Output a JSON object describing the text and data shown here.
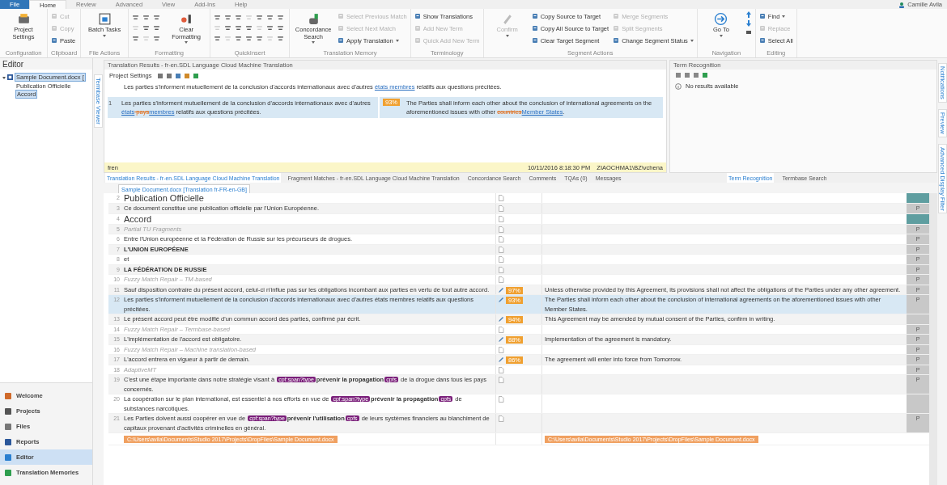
{
  "ribbon": {
    "tabs": [
      {
        "label": "File",
        "kind": "file",
        "selected": false
      },
      {
        "label": "Home",
        "kind": "tab",
        "selected": true
      },
      {
        "label": "Review",
        "kind": "tab",
        "selected": false
      },
      {
        "label": "Advanced",
        "kind": "tab",
        "selected": false
      },
      {
        "label": "View",
        "kind": "tab",
        "selected": false
      },
      {
        "label": "Add-Ins",
        "kind": "tab",
        "selected": false
      },
      {
        "label": "Help",
        "kind": "tab",
        "selected": false
      }
    ],
    "user": "Camille Avila",
    "groups": [
      {
        "label": "Configuration",
        "items": [
          {
            "kind": "large",
            "label": "Project Settings",
            "dropdown": false,
            "disabled": false
          }
        ]
      },
      {
        "label": "Clipboard",
        "items": [
          {
            "kind": "small",
            "label": "Cut",
            "dropdown": false,
            "disabled": true
          },
          {
            "kind": "small",
            "label": "Copy",
            "dropdown": false,
            "disabled": true
          },
          {
            "kind": "small",
            "label": "Paste",
            "dropdown": false,
            "disabled": false
          }
        ]
      },
      {
        "label": "File Actions",
        "items": [
          {
            "kind": "large",
            "label": "Batch Tasks",
            "dropdown": true,
            "disabled": false
          }
        ]
      },
      {
        "label": "Formatting",
        "items": [
          {
            "kind": "grid"
          },
          {
            "kind": "large",
            "label": "Clear Formatting",
            "dropdown": true,
            "disabled": false
          }
        ]
      },
      {
        "label": "QuickInsert",
        "items": [
          {
            "kind": "grid"
          }
        ]
      },
      {
        "label": "Translation Memory",
        "items": [
          {
            "kind": "large",
            "label": "Concordance Search",
            "dropdown": true,
            "disabled": false
          },
          {
            "kind": "small",
            "label": "Select Previous Match",
            "dropdown": false,
            "disabled": true
          },
          {
            "kind": "small",
            "label": "Select Next Match",
            "dropdown": false,
            "disabled": true
          },
          {
            "kind": "small",
            "label": "Apply Translation",
            "dropdown": true,
            "disabled": false
          }
        ]
      },
      {
        "label": "Terminology",
        "items": [
          {
            "kind": "small",
            "label": "Show Translations",
            "dropdown": false,
            "disabled": false
          },
          {
            "kind": "small",
            "label": "Add New Term",
            "dropdown": false,
            "disabled": true
          },
          {
            "kind": "small",
            "label": "Quick Add New Term",
            "dropdown": false,
            "disabled": true
          }
        ]
      },
      {
        "label": "Segment Actions",
        "items": [
          {
            "kind": "large",
            "label": "Confirm",
            "dropdown": true,
            "disabled": true
          },
          {
            "kind": "small",
            "label": "Copy Source to Target",
            "dropdown": false,
            "disabled": false
          },
          {
            "kind": "small",
            "label": "Copy All Source to Target",
            "dropdown": false,
            "disabled": false
          },
          {
            "kind": "small",
            "label": "Clear Target Segment",
            "dropdown": false,
            "disabled": false
          },
          {
            "kind": "small",
            "label": "Merge Segments",
            "dropdown": false,
            "disabled": true
          },
          {
            "kind": "small",
            "label": "Split Segments",
            "dropdown": false,
            "disabled": true
          },
          {
            "kind": "small",
            "label": "Change Segment Status",
            "dropdown": true,
            "disabled": false
          }
        ]
      },
      {
        "label": "Navigation",
        "items": [
          {
            "kind": "large",
            "label": "Go To",
            "dropdown": true,
            "disabled": false
          },
          {
            "kind": "arrows"
          }
        ]
      },
      {
        "label": "Editing",
        "items": [
          {
            "kind": "small",
            "label": "Find",
            "dropdown": true,
            "disabled": false
          },
          {
            "kind": "small",
            "label": "Replace",
            "dropdown": false,
            "disabled": true
          },
          {
            "kind": "small",
            "label": "Select All",
            "dropdown": false,
            "disabled": false
          }
        ]
      }
    ]
  },
  "sidebar": {
    "title": "Editor",
    "tree": [
      {
        "label": "Sample Document.docx [",
        "selected": true,
        "children": [
          {
            "label": "Publication Officielle",
            "selected": false
          },
          {
            "label": "Accord",
            "selected": true
          }
        ]
      }
    ],
    "nav": [
      {
        "label": "Welcome",
        "selected": false
      },
      {
        "label": "Projects",
        "selected": false
      },
      {
        "label": "Files",
        "selected": false
      },
      {
        "label": "Reports",
        "selected": false
      },
      {
        "label": "Editor",
        "selected": true
      },
      {
        "label": "Translation Memories",
        "selected": false
      }
    ],
    "vertical_tab": "Termbase Viewer"
  },
  "results": {
    "title": "Translation Results - fr-en.SDL Language Cloud Machine Translation",
    "toolbar_label": "Project Settings",
    "source": [
      {
        "kind": "text",
        "text": "Les parties s'informent mutuellement de la conclusion d'accords internationaux avec d'autres "
      },
      {
        "kind": "inserted",
        "text": "états membres"
      },
      {
        "kind": "text",
        "text": " relatifs aux questions précitées."
      }
    ],
    "hit": {
      "number": "1",
      "match": "93%",
      "source": [
        {
          "kind": "text",
          "text": "Les parties s'informent mutuellement de la conclusion d'accords internationaux avec d'autres "
        },
        {
          "kind": "inserted",
          "text": "états"
        },
        {
          "kind": "deleted",
          "text": " pays"
        },
        {
          "kind": "inserted",
          "text": "membres"
        },
        {
          "kind": "text",
          "text": " relatifs aux questions précitées."
        }
      ],
      "target": [
        {
          "kind": "text",
          "text": "The Parties shall inform each other about the conclusion of international agreements on the aforementioned issues with other "
        },
        {
          "kind": "deleted",
          "text": "countries"
        },
        {
          "kind": "inserted",
          "text": "Member States"
        },
        {
          "kind": "text",
          "text": "."
        }
      ]
    },
    "footer": {
      "origin": "fren",
      "date": "10/11/2016 8:18:30 PM",
      "user": "ZIAOCHMA1\\BZ\\vchena"
    }
  },
  "term_panel": {
    "title": "Term Recognition",
    "message": "No results available"
  },
  "panel_tabs": [
    {
      "label": "Translation Results - fr-en.SDL Language Cloud Machine Translation",
      "selected": true
    },
    {
      "label": "Fragment Matches - fr-en.SDL Language Cloud Machine Translation",
      "selected": false
    },
    {
      "label": "Concordance Search",
      "selected": false
    },
    {
      "label": "Comments",
      "selected": false
    },
    {
      "label": "TQAs (0)",
      "selected": false
    },
    {
      "label": "Messages",
      "selected": false
    }
  ],
  "term_tabs": [
    {
      "label": "Term Recognition",
      "selected": true
    },
    {
      "label": "Termbase Search",
      "selected": false
    }
  ],
  "right_tabs": [
    "Notifications",
    "Preview",
    "Advanced Display Filter"
  ],
  "editor": {
    "tab": "Sample Document.docx [Translation fr-FR-en-GB]",
    "segments": [
      {
        "num": "2",
        "kind": "heading",
        "selected": false,
        "color": "#5f9ea0",
        "parts": [
          {
            "kind": "text",
            "text": "Publication Officielle"
          }
        ]
      },
      {
        "num": "3",
        "kind": "normal",
        "selected": false,
        "color": "#c8c8c8",
        "status": "P",
        "parts": [
          {
            "kind": "text",
            "text": "Ce document constitue une publication officielle par l'Union Européenne."
          }
        ]
      },
      {
        "num": "4",
        "kind": "heading",
        "selected": false,
        "color": "#5f9ea0",
        "parts": [
          {
            "kind": "text",
            "text": "Accord"
          }
        ]
      },
      {
        "num": "5",
        "kind": "label",
        "selected": false,
        "color": "#c8c8c8",
        "status": "P",
        "parts": [
          {
            "kind": "text",
            "text": "Partial TU Fragments"
          }
        ]
      },
      {
        "num": "6",
        "kind": "normal",
        "selected": false,
        "color": "#c8c8c8",
        "status": "P",
        "parts": [
          {
            "kind": "text",
            "text": "Entre l'Union européenne et la Fédération de Russie sur les précurseurs de drogues."
          }
        ]
      },
      {
        "num": "7",
        "kind": "bold",
        "selected": false,
        "color": "#c8c8c8",
        "status": "P",
        "parts": [
          {
            "kind": "text",
            "text": "L'UNION EUROPÉENE"
          }
        ]
      },
      {
        "num": "8",
        "kind": "normal",
        "selected": false,
        "color": "#c8c8c8",
        "status": "P",
        "parts": [
          {
            "kind": "text",
            "text": "et"
          }
        ]
      },
      {
        "num": "9",
        "kind": "bold",
        "selected": false,
        "color": "#c8c8c8",
        "status": "P",
        "parts": [
          {
            "kind": "text",
            "text": "LA FÉDÉRATION DE RUSSIE"
          }
        ]
      },
      {
        "num": "10",
        "kind": "label",
        "selected": false,
        "color": "#c8c8c8",
        "status": "P",
        "parts": [
          {
            "kind": "text",
            "text": "Fuzzy Match Repair – TM-based"
          }
        ]
      },
      {
        "num": "11",
        "kind": "normal",
        "selected": false,
        "color": "#c8c8c8",
        "status": "P",
        "match": "97%",
        "target": "Unless otherwise provided by this Agreement, its provisions shall not affect the obligations of the Parties under any other agreement.",
        "parts": [
          {
            "kind": "text",
            "text": "Sauf disposition contraire du présent accord, celui-ci n'influe pas sur les obligations incombant aux parties en vertu de tout autre accord."
          }
        ]
      },
      {
        "num": "12",
        "kind": "normal",
        "selected": true,
        "color": "#c8c8c8",
        "status": "P",
        "match": "93%",
        "target": "The Parties shall inform each other about the conclusion of international agreements on the aforementioned issues with other Member States.",
        "parts": [
          {
            "kind": "text",
            "text": "Les parties s'informent mutuellement de la conclusion d'accords internationaux avec d'autres états membres relatifs aux questions précitées."
          }
        ]
      },
      {
        "num": "13",
        "kind": "normal",
        "selected": false,
        "color": "#c8c8c8",
        "match": "94%",
        "target": "This Agreement may be amended by mutual consent of the Parties, confirm in writing.",
        "parts": [
          {
            "kind": "text",
            "text": "Le présent accord peut être modifié d'un commun accord des parties, confirmé par écrit."
          }
        ]
      },
      {
        "num": "14",
        "kind": "label",
        "selected": false,
        "color": "#c8c8c8",
        "status": "P",
        "parts": [
          {
            "kind": "text",
            "text": "Fuzzy Match Repair – Termbase-based"
          }
        ]
      },
      {
        "num": "15",
        "kind": "normal",
        "selected": false,
        "color": "#c8c8c8",
        "status": "P",
        "match": "88%",
        "target": "Implementation of the agreement is mandatory.",
        "parts": [
          {
            "kind": "text",
            "text": "L'implémentation de l'accord est obligatoire."
          }
        ]
      },
      {
        "num": "16",
        "kind": "label",
        "selected": false,
        "color": "#c8c8c8",
        "status": "P",
        "parts": [
          {
            "kind": "text",
            "text": "Fuzzy Match Repair – Machine translation-based"
          }
        ]
      },
      {
        "num": "17",
        "kind": "normal",
        "selected": false,
        "color": "#c8c8c8",
        "status": "P",
        "match": "86%",
        "target": "The agreement will enter into force from Tomorrow.",
        "parts": [
          {
            "kind": "text",
            "text": "L'accord entrera en vigueur à partir de demain."
          }
        ]
      },
      {
        "num": "18",
        "kind": "label",
        "selected": false,
        "color": "#c8c8c8",
        "status": "P",
        "parts": [
          {
            "kind": "text",
            "text": "AdaptiveMT"
          }
        ]
      },
      {
        "num": "19",
        "kind": "normal",
        "selected": false,
        "color": "#c8c8c8",
        "status": "P",
        "parts": [
          {
            "kind": "text",
            "text": "C'est une étape importante dans notre stratégie visant à "
          },
          {
            "kind": "tag",
            "text": "cpf:span?type"
          },
          {
            "kind": "bold",
            "text": "prévenir la propagation"
          },
          {
            "kind": "tag",
            "text": "cpfs"
          },
          {
            "kind": "text",
            "text": " de la drogue dans tous les pays concernés."
          }
        ]
      },
      {
        "num": "20",
        "kind": "normal",
        "selected": false,
        "color": "#c8c8c8",
        "parts": [
          {
            "kind": "text",
            "text": "La coopération sur le plan international, est essentiel à nos efforts en vue de "
          },
          {
            "kind": "tag",
            "text": "cpf:span?type"
          },
          {
            "kind": "bold",
            "text": "prévenir la propagation"
          },
          {
            "kind": "tag",
            "text": "cpfs"
          },
          {
            "kind": "text",
            "text": " de substances narcotiques."
          }
        ]
      },
      {
        "num": "21",
        "kind": "normal",
        "selected": false,
        "color": "#c8c8c8",
        "status": "P",
        "parts": [
          {
            "kind": "text",
            "text": "Les Parties doivent aussi coopérer en vue de "
          },
          {
            "kind": "tag",
            "text": "cpf:span?type"
          },
          {
            "kind": "bold",
            "text": "prévenir l'utilisation"
          },
          {
            "kind": "tag",
            "text": "cpfs"
          },
          {
            "kind": "text",
            "text": " de leurs systèmes financiers au blanchiment de capitaux provenant d'activités criminelles en général."
          }
        ]
      }
    ],
    "source_path": "C:\\Users\\avila\\Documents\\Studio 2017\\Projects\\DropFiles\\Sample Document.docx",
    "target_path": "C:\\Users\\avila\\Documents\\Studio 2017\\Projects\\DropFiles\\Sample Document.docx"
  }
}
